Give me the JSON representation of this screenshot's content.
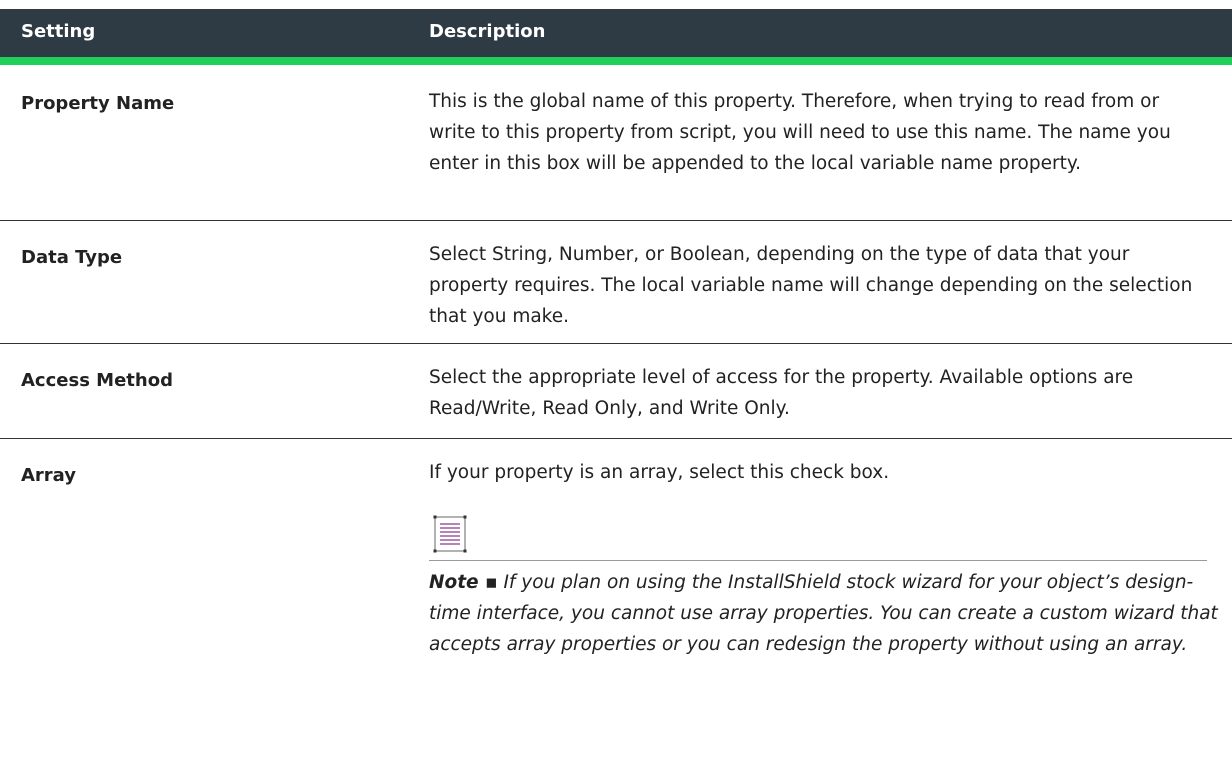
{
  "table": {
    "headers": {
      "setting": "Setting",
      "description": "Description"
    },
    "rows": [
      {
        "setting": "Property Name",
        "description": "This is the global name of this property. Therefore, when trying to read from or write to this property from script, you will need to use this name. The name you enter in this box will be appended to the local variable name property."
      },
      {
        "setting": "Data Type",
        "description": "Select String, Number, or Boolean, depending on the type of data that your property requires. The local variable name will change depending on the selection that you make."
      },
      {
        "setting": "Access Method",
        "description": "Select the appropriate level of access for the property. Available options are Read/Write, Read Only, and Write Only."
      },
      {
        "setting": "Array",
        "description": "If your property is an array, select this check box.",
        "note": {
          "icon": "note-icon",
          "label": "Note ▪",
          "text": "If you plan on using the InstallShield stock wizard for your object’s design-time interface, you cannot use array properties. You can create a custom wizard that accepts array properties or you can redesign the property without using an array."
        }
      }
    ]
  },
  "colors": {
    "header_bg": "#2e3a44",
    "header_accent": "#20d05a",
    "note_icon": "#8a3a8a"
  }
}
